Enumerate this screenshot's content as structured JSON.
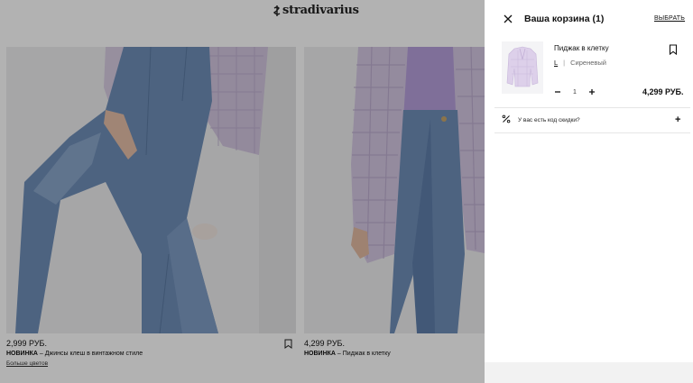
{
  "store": {
    "brand": "stradivarius",
    "products": [
      {
        "price": "2,999 РУБ.",
        "badge": "НОВИНКА",
        "title": " – Джинсы клеш в винтажном стиле",
        "colors_link": "Больше цветов"
      },
      {
        "price": "4,299 РУБ.",
        "badge": "НОВИНКА",
        "title": " – Пиджак в клетку",
        "colors_link": ""
      }
    ]
  },
  "cart": {
    "title": "Ваша корзина (1)",
    "select_label": "ВЫБРАТЬ",
    "item": {
      "name": "Пиджак в клетку",
      "size": "L",
      "separator": "|",
      "color": "Сиреневый",
      "quantity": "1",
      "price": "4,299 РУБ."
    },
    "promo": {
      "label": "У вас есть код скидки?",
      "expand_symbol": "+"
    }
  },
  "colors": {
    "overlay": "#000000",
    "jacket_lilac": "#c9b6dd",
    "denim": "#6f8eb8"
  }
}
